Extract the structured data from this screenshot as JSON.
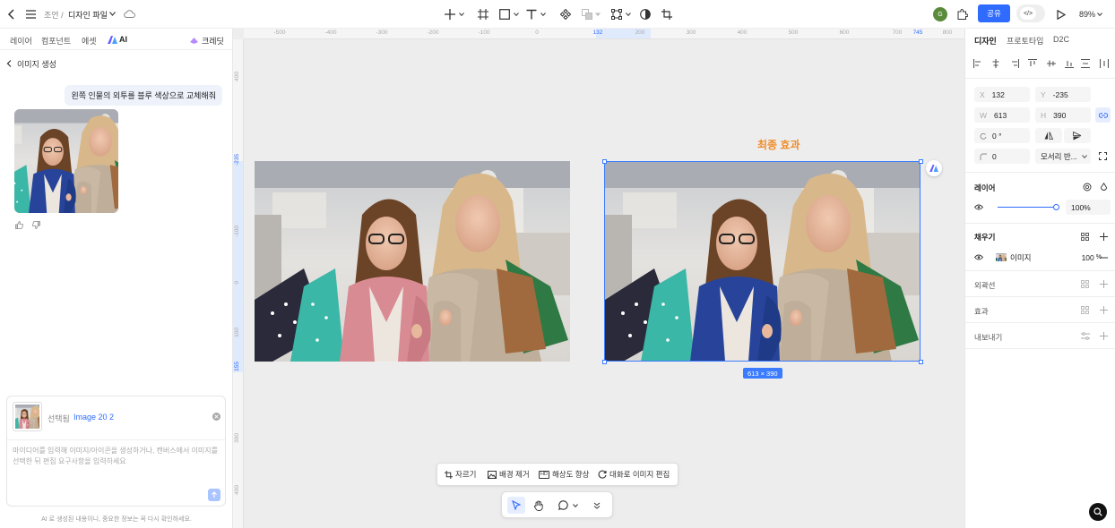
{
  "topbar": {
    "breadcrumb_root": "조언",
    "breadcrumb_sep": "/",
    "file_name": "디자인 파일",
    "share_label": "공유",
    "zoom": "89%",
    "avatar_letter": "G"
  },
  "left_tabs": [
    {
      "label": "레이어"
    },
    {
      "label": "컴포넌트"
    },
    {
      "label": "에셋"
    },
    {
      "label": "AI"
    }
  ],
  "credits_label": "크레딧",
  "chat": {
    "back_title": "이미지 생성",
    "user_message": "왼쪽 인물의 외투를 블루 색상으로 교체해줘",
    "composer": {
      "selected_prefix": "선택됨",
      "selected_name": "Image 20 2",
      "placeholder": "마이디어를 입력해 이미지/아이콘을 생성하거나, 캔버스에서 이미지를 선택한 뒤 편집 요구사항을 입력하세요"
    },
    "disclaimer": "AI 로 생성된 내용이니, 중요한 정보는 꼭 다시 확인하세요."
  },
  "ruler": {
    "top": [
      "-500",
      "-400",
      "-300",
      "-200",
      "-100",
      "0",
      "132",
      "200",
      "300",
      "400",
      "500",
      "600",
      "700",
      "745",
      "800"
    ],
    "left": [
      "400",
      "-235",
      "-100",
      "0",
      "100",
      "155",
      "300",
      "400"
    ]
  },
  "canvas": {
    "result_label": "최종 효과",
    "dimension_badge": "613 × 390",
    "colors": {
      "selection": "#3a7bff",
      "result_label": "#f08c2a"
    }
  },
  "image_toolbar": {
    "crop": "자르기",
    "remove_bg": "배경 제거",
    "upscale": "해상도 향상",
    "edit_chat": "대화로 이미지 편집",
    "hd_badge": "HD"
  },
  "right_tabs": [
    {
      "label": "디자인"
    },
    {
      "label": "프로토타입"
    },
    {
      "label": "D2C"
    }
  ],
  "props": {
    "x_label": "X",
    "x": "132",
    "y_label": "Y",
    "y": "-235",
    "w_label": "W",
    "w": "613",
    "h_label": "H",
    "h": "390",
    "rotation": "0 °",
    "radius": "0",
    "corner_mode": "모서리 반..."
  },
  "layer": {
    "title": "레이어",
    "opacity": "100%",
    "opacity_fraction": 1.0
  },
  "fill": {
    "title": "채우기",
    "type": "이미지",
    "opacity": "100",
    "unit": "%"
  },
  "stroke": {
    "title": "외곽선"
  },
  "effects": {
    "title": "효과"
  },
  "export": {
    "title": "내보내기"
  }
}
